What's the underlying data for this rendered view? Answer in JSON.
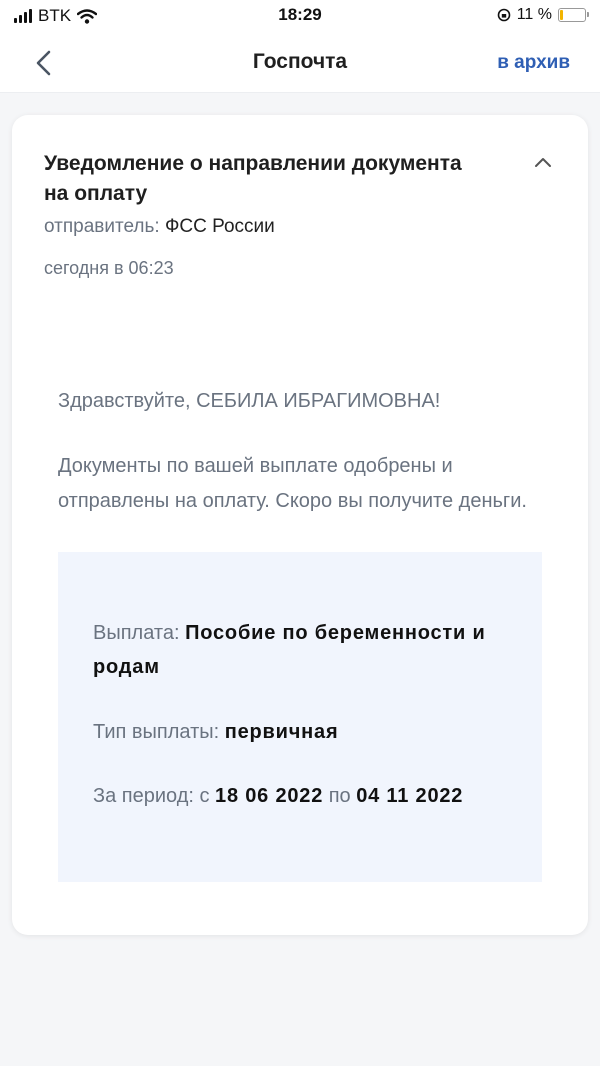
{
  "status_bar": {
    "carrier": "BTK",
    "time": "18:29",
    "battery": "11 %"
  },
  "header": {
    "title": "Госпочта",
    "archive_label": "в архив"
  },
  "message": {
    "title": "Уведомление о направлении документа на оплату",
    "sender_label": "отправитель:",
    "sender_value": "ФСС России",
    "date": "сегодня в 06:23",
    "greeting": "Здравствуйте, СЕБИЛА ИБРАГИМОВНА!",
    "body": "Документы по вашей выплате одобрены и отправлены на оплату. Скоро вы получите деньги.",
    "details": {
      "payment_label": "Выплата:",
      "payment_value": "Пособие по беременности и родам",
      "type_label": "Тип выплаты:",
      "type_value": "первичная",
      "period_label": "За период: с",
      "period_from": "18 06 2022",
      "period_to_label": "по",
      "period_to": "04 11 2022"
    }
  },
  "colors": {
    "accent": "#2f5fb4",
    "muted_text": "#6a7380",
    "info_background": "#f1f5fd"
  }
}
